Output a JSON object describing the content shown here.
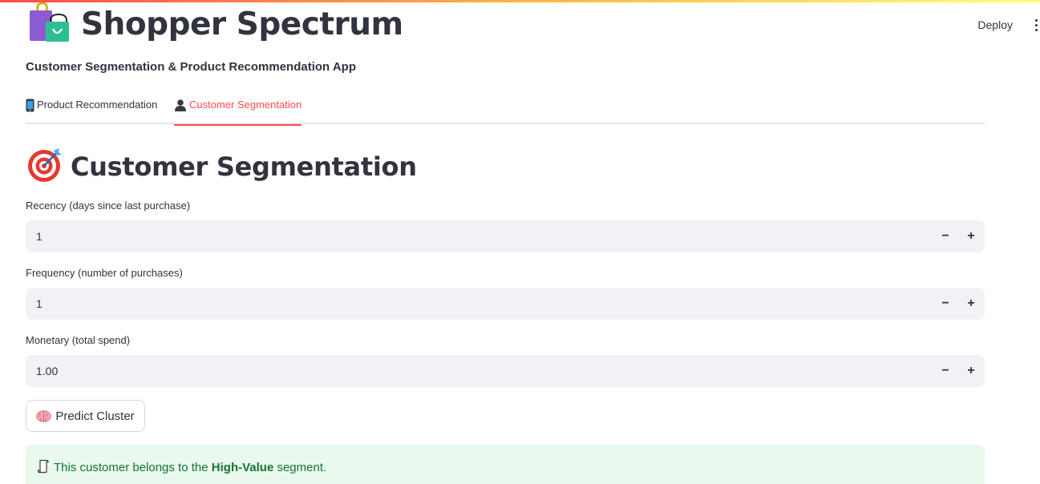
{
  "header": {
    "deploy_label": "Deploy",
    "menu_icon": "kebab-menu-icon"
  },
  "app": {
    "title": "Shopper Spectrum",
    "title_icon": "shopping-bags-icon",
    "subtitle": "Customer Segmentation & Product Recommendation App"
  },
  "tabs": [
    {
      "label": "Product Recommendation",
      "icon": "mobile-phone-icon",
      "active": false
    },
    {
      "label": "Customer Segmentation",
      "icon": "bust-silhouette-icon",
      "active": true
    }
  ],
  "section": {
    "title": "Customer Segmentation",
    "icon": "bullseye-dart-icon"
  },
  "form": {
    "recency": {
      "label": "Recency (days since last purchase)",
      "value": "1"
    },
    "frequency": {
      "label": "Frequency (number of purchases)",
      "value": "1"
    },
    "monetary": {
      "label": "Monetary (total spend)",
      "value": "1.00"
    },
    "minus_label": "−",
    "plus_label": "+",
    "predict_button": {
      "label": "Predict Cluster",
      "icon": "brain-icon"
    }
  },
  "result": {
    "prefix": "This customer belongs to the",
    "segment": "High-Value",
    "suffix": "segment.",
    "icon": "scroll-icon"
  },
  "colors": {
    "accent": "#ff4b4b",
    "text": "#31333f",
    "input_bg": "#f0f2f6",
    "success_bg": "#e9f9ee",
    "success_text": "#177233"
  }
}
